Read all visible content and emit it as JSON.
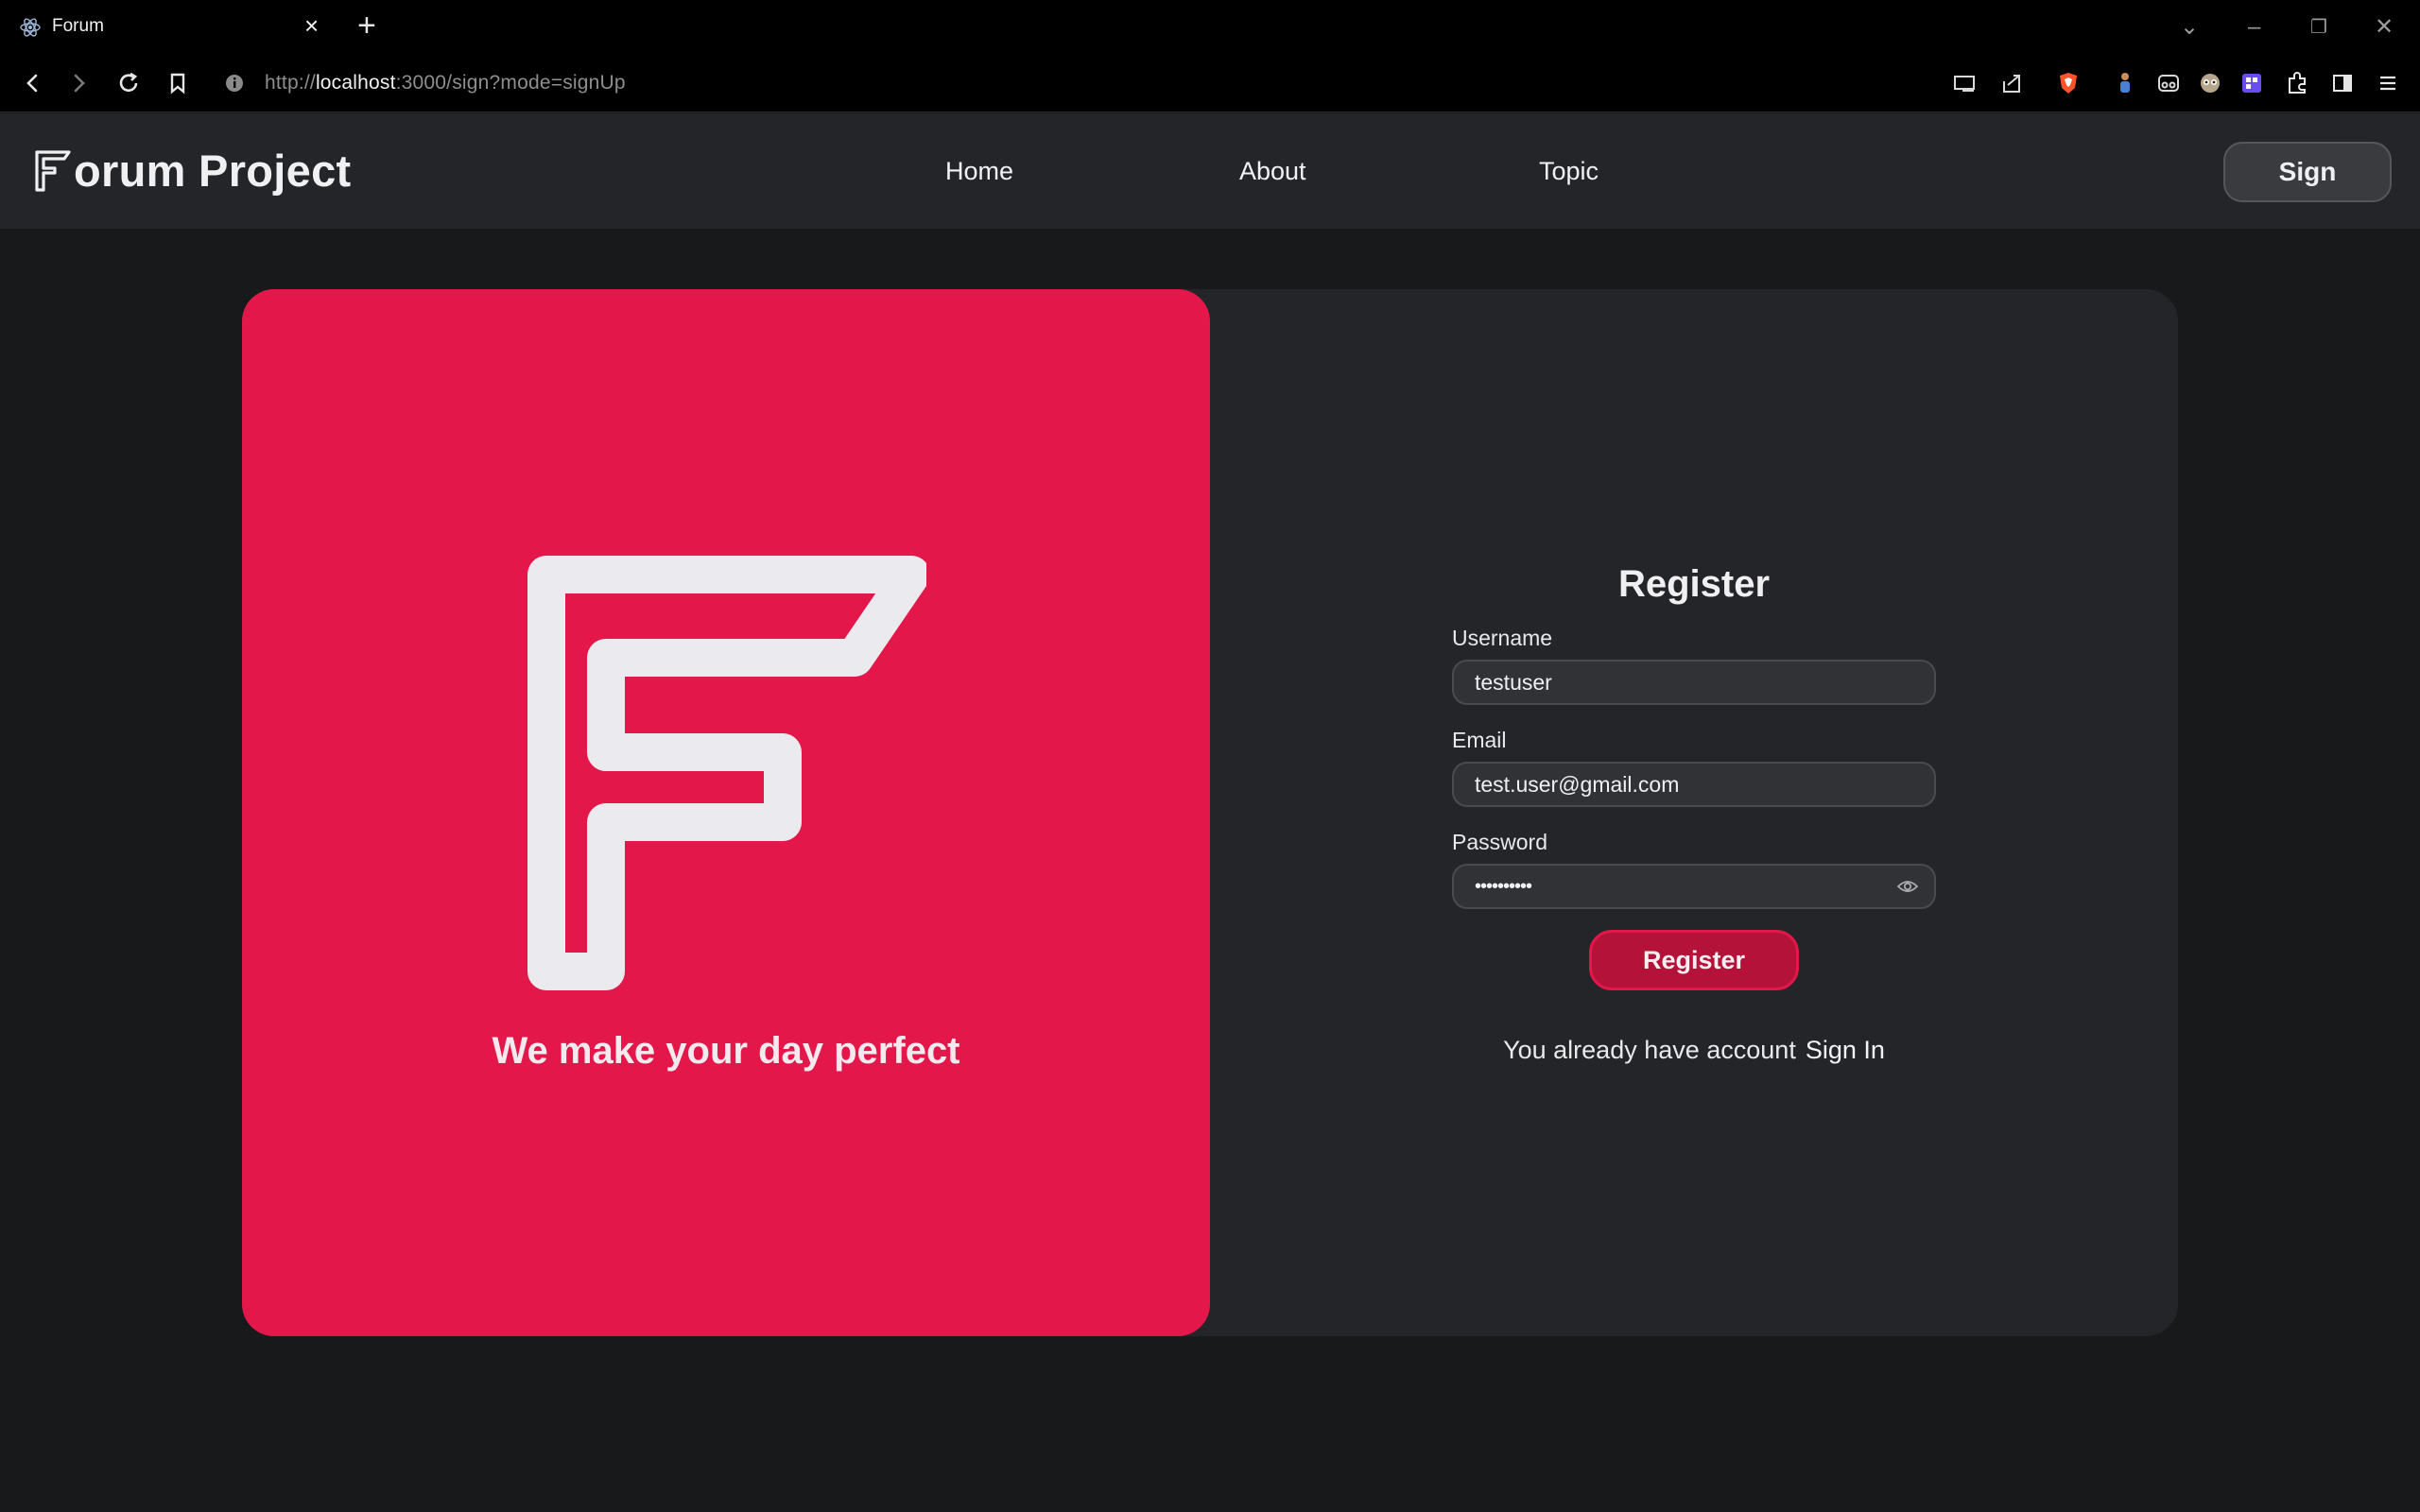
{
  "browser": {
    "tab_title": "Forum",
    "url_scheme": "http://",
    "url_host": "localhost",
    "url_rest": ":3000/sign?mode=signUp"
  },
  "header": {
    "brand_rest": "orum Project",
    "nav": [
      {
        "label": "Home"
      },
      {
        "label": "About"
      },
      {
        "label": "Topic"
      }
    ],
    "sign_label": "Sign"
  },
  "hero": {
    "tagline": "We make your day perfect"
  },
  "form": {
    "title": "Register",
    "username_label": "Username",
    "username_value": "testuser",
    "email_label": "Email",
    "email_value": "test.user@gmail.com",
    "password_label": "Password",
    "password_value": "••••••••••",
    "submit_label": "Register",
    "switch_text": "You already have account",
    "switch_link": "Sign In"
  },
  "colors": {
    "accent": "#e3174a",
    "button": "#b5123a",
    "background": "#18191b",
    "surface": "#242528"
  }
}
